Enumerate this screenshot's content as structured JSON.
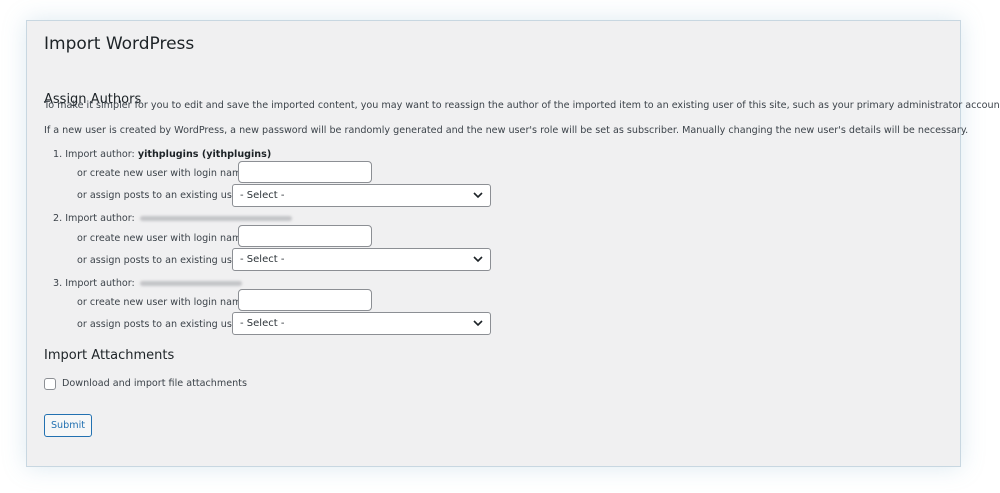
{
  "page": {
    "title": "Import WordPress"
  },
  "assign_authors": {
    "heading": "Assign Authors",
    "intro": "To make it simpler for you to edit and save the imported content, you may want to reassign the author of the imported item to an existing user of this site, such as your primary administrator account.",
    "note": "If a new user is created by WordPress, a new password will be randomly generated and the new user's role will be set as subscriber. Manually changing the new user's details will be necessary.",
    "authors": [
      {
        "prefix": "1. Import author:",
        "name": "yithplugins (yithplugins)",
        "create_label": "or create new user with login name:",
        "create_value": "",
        "assign_label": "or assign posts to an existing user:",
        "assign_selected": "- Select -"
      },
      {
        "prefix": "2. Import author:",
        "name": "",
        "create_label": "or create new user with login name:",
        "create_value": "",
        "assign_label": "or assign posts to an existing user:",
        "assign_selected": "- Select -"
      },
      {
        "prefix": "3. Import author:",
        "name": "",
        "create_label": "or create new user with login name:",
        "create_value": "",
        "assign_label": "or assign posts to an existing user:",
        "assign_selected": "- Select -"
      }
    ]
  },
  "attachments": {
    "heading": "Import Attachments",
    "checkbox_label": "Download and import file attachments",
    "checked": false
  },
  "submit": {
    "label": "Submit"
  },
  "colors": {
    "panel_bg": "#f0f0f1",
    "accent": "#2271b1",
    "text": "#3c434a"
  }
}
